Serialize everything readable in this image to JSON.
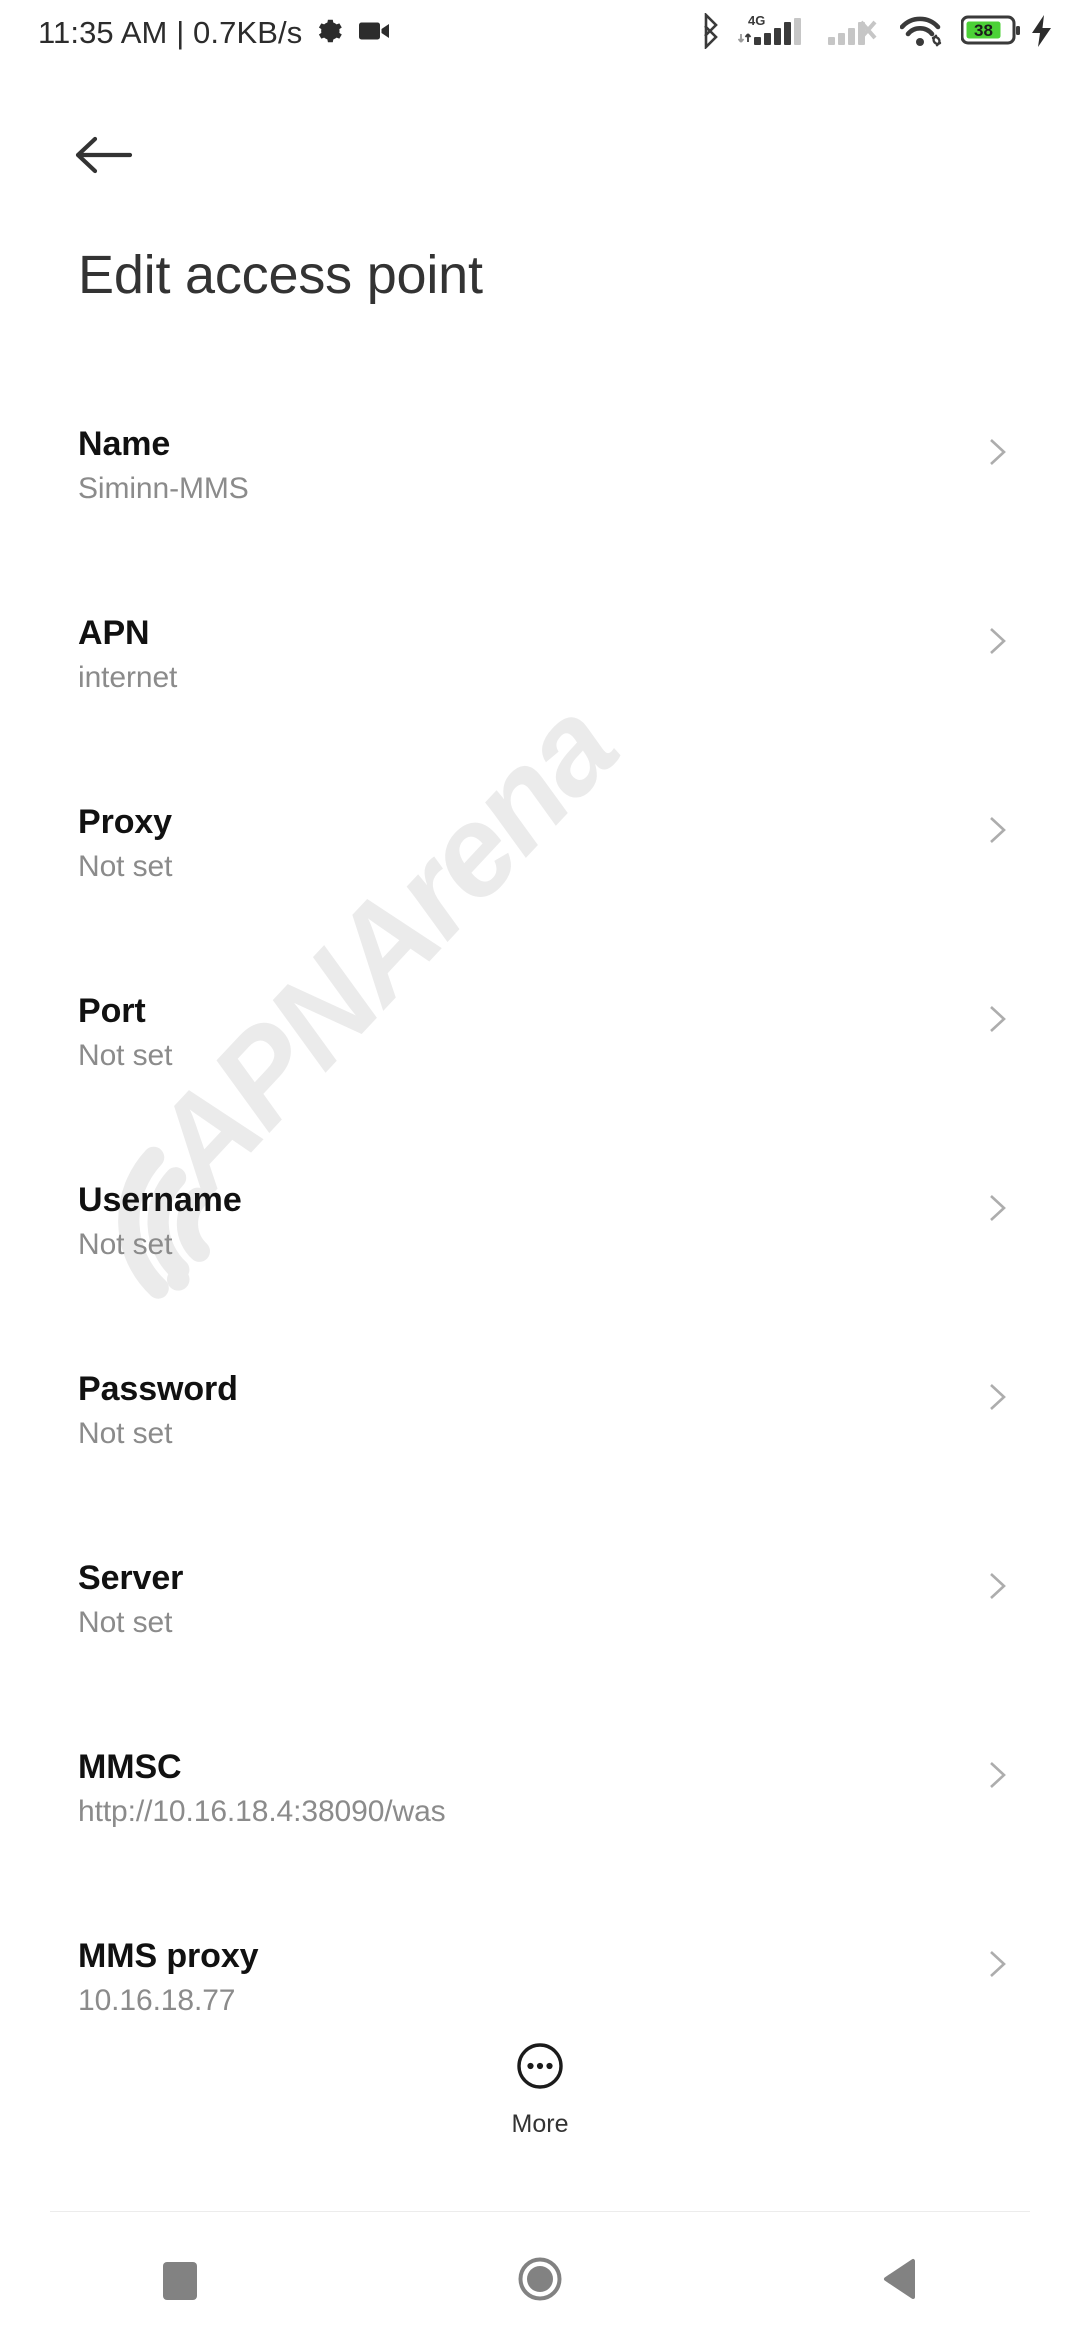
{
  "status_bar": {
    "clock": "11:35 AM | 0.7KB/s",
    "icons": [
      {
        "name": "gear-icon"
      },
      {
        "name": "video-camera-icon"
      },
      {
        "name": "bluetooth-icon"
      },
      {
        "name": "mobile-signal-4g-icon",
        "label": "4G"
      },
      {
        "name": "mobile-signal-2-icon"
      },
      {
        "name": "wifi-icon"
      },
      {
        "name": "battery-icon",
        "level": "38"
      }
    ],
    "network_label": "4G",
    "battery_level": "38",
    "battery_color": "#4cd137",
    "charging": true
  },
  "header": {
    "back_label": "Back",
    "title": "Edit access point"
  },
  "watermark": {
    "text": "APNArena",
    "color": "#ebebeb"
  },
  "settings": {
    "items": [
      {
        "title": "Name",
        "summary": "Siminn-MMS"
      },
      {
        "title": "APN",
        "summary": "internet"
      },
      {
        "title": "Proxy",
        "summary": "Not set"
      },
      {
        "title": "Port",
        "summary": "Not set"
      },
      {
        "title": "Username",
        "summary": "Not set"
      },
      {
        "title": "Password",
        "summary": "Not set"
      },
      {
        "title": "Server",
        "summary": "Not set"
      },
      {
        "title": "MMSC",
        "summary": "http://10.16.18.4:38090/was"
      },
      {
        "title": "MMS proxy",
        "summary": "10.16.18.77"
      }
    ]
  },
  "more": {
    "label": "More",
    "icon": "more-circle-icon"
  },
  "nav_bar": {
    "recents_label": "Recents",
    "home_label": "Home",
    "back_label": "Back",
    "color": "#828282"
  }
}
